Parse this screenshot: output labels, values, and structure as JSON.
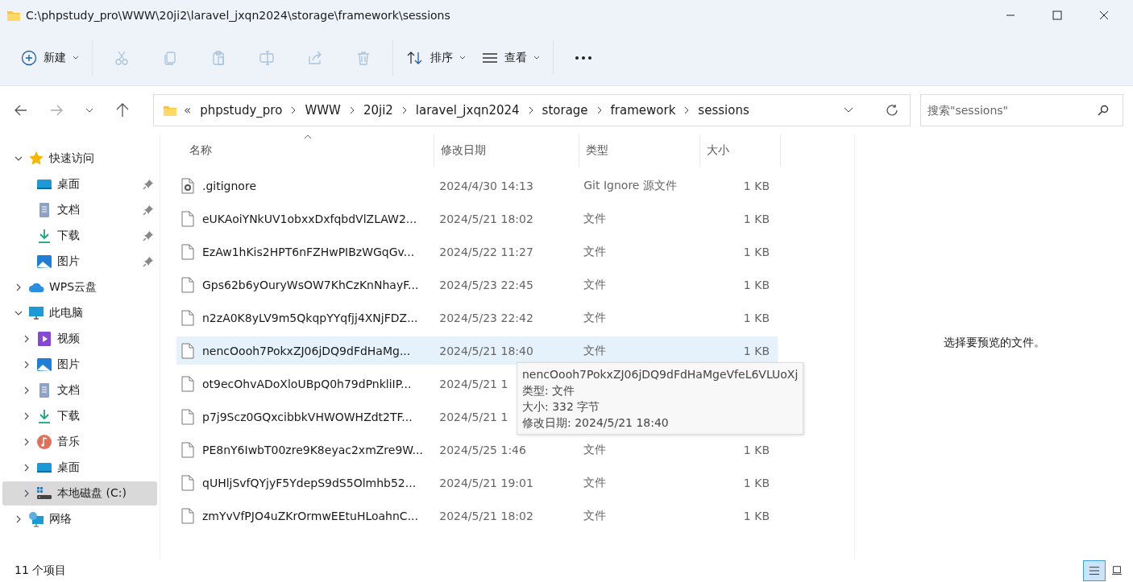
{
  "window": {
    "title": "C:\\phpstudy_pro\\WWW\\20ji2\\laravel_jxqn2024\\storage\\framework\\sessions"
  },
  "toolbar": {
    "new_label": "新建",
    "actions": [
      {
        "kind": "cut",
        "disabled": true
      },
      {
        "kind": "copy",
        "disabled": true
      },
      {
        "kind": "paste",
        "disabled": true
      },
      {
        "kind": "rename",
        "disabled": true
      },
      {
        "kind": "share",
        "disabled": true
      },
      {
        "kind": "delete",
        "disabled": true
      }
    ],
    "sort_label": "排序",
    "view_label": "查看"
  },
  "address": {
    "overflow_mark": "«",
    "path": [
      "phpstudy_pro",
      "WWW",
      "20ji2",
      "laravel_jxqn2024",
      "storage",
      "framework",
      "sessions"
    ]
  },
  "search": {
    "placeholder": "搜索\"sessions\""
  },
  "sidebar": {
    "items": [
      {
        "label": "快速访问",
        "kind": "star",
        "expanded": true,
        "selected": false,
        "children": [
          {
            "label": "桌面",
            "kind": "desktop",
            "pinned": true,
            "selected": false
          },
          {
            "label": "文档",
            "kind": "document",
            "pinned": true,
            "selected": false
          },
          {
            "label": "下载",
            "kind": "download",
            "pinned": true,
            "selected": false
          },
          {
            "label": "图片",
            "kind": "pictures",
            "pinned": true,
            "selected": false
          }
        ]
      },
      {
        "label": "WPS云盘",
        "kind": "cloud",
        "expanded": false,
        "selected": false
      },
      {
        "label": "此电脑",
        "kind": "pc",
        "expanded": true,
        "selected": false,
        "children": [
          {
            "label": "视频",
            "kind": "video",
            "expanded": false,
            "selected": false
          },
          {
            "label": "图片",
            "kind": "pictures",
            "expanded": false,
            "selected": false
          },
          {
            "label": "文档",
            "kind": "document",
            "expanded": false,
            "selected": false
          },
          {
            "label": "下载",
            "kind": "download",
            "expanded": false,
            "selected": false
          },
          {
            "label": "音乐",
            "kind": "music",
            "expanded": false,
            "selected": false
          },
          {
            "label": "桌面",
            "kind": "desktop",
            "expanded": false,
            "selected": false
          },
          {
            "label": "本地磁盘 (C:)",
            "kind": "drive",
            "expanded": false,
            "selected": true
          }
        ]
      },
      {
        "label": "网络",
        "kind": "network",
        "expanded": false,
        "selected": false
      }
    ]
  },
  "table": {
    "columns": [
      {
        "label": "名称",
        "sorted": true
      },
      {
        "label": "修改日期"
      },
      {
        "label": "类型"
      },
      {
        "label": "大小"
      }
    ],
    "rows": [
      {
        "kind": "settings-file",
        "name": ".gitignore",
        "date": "2024/4/30 14:13",
        "type": "Git Ignore 源文件",
        "size": "1 KB",
        "selected": false
      },
      {
        "kind": "file",
        "name": "eUKAoiYNkUV1obxxDxfqbdVlZLAW2...",
        "date": "2024/5/21 18:02",
        "type": "文件",
        "size": "1 KB",
        "selected": false
      },
      {
        "kind": "file",
        "name": "EzAw1hKis2HPT6nFZHwPIBzWGqGv...",
        "date": "2024/5/22 11:27",
        "type": "文件",
        "size": "1 KB",
        "selected": false
      },
      {
        "kind": "file",
        "name": "Gps62b6yOuryWsOW7KhCzKnNhayF...",
        "date": "2024/5/23 22:45",
        "type": "文件",
        "size": "1 KB",
        "selected": false
      },
      {
        "kind": "file",
        "name": "n2zA0K8yLV9m5QkqpYYqfjj4XNjFDZ...",
        "date": "2024/5/23 22:42",
        "type": "文件",
        "size": "1 KB",
        "selected": false
      },
      {
        "kind": "file",
        "name": "nencOooh7PokxZJ06jDQ9dFdHaMg...",
        "date": "2024/5/21 18:40",
        "type": "文件",
        "size": "1 KB",
        "selected": true
      },
      {
        "kind": "file",
        "name": "ot9ecOhvADoXloUBpQ0h79dPnkliIP...",
        "date": "2024/5/21 1",
        "selected": false
      },
      {
        "kind": "file",
        "name": "p7j9Scz0GQxcibbkVHWOWHZdt2TF...",
        "date": "2024/5/21 1",
        "selected": false
      },
      {
        "kind": "file",
        "name": "PE8nY6IwbT00zre9K8eyac2xmZre9W...",
        "date": "2024/5/25 1:46",
        "type": "文件",
        "size": "1 KB",
        "selected": false
      },
      {
        "kind": "file",
        "name": "qUHljSvfQYjyF5YdepS9dS5Olmhb52...",
        "date": "2024/5/21 19:01",
        "type": "文件",
        "size": "1 KB",
        "selected": false
      },
      {
        "kind": "file",
        "name": "zmYvVfPJO4uZKrOrmwEEtuHLoahnC...",
        "date": "2024/5/21 18:02",
        "type": "文件",
        "size": "1 KB",
        "selected": false
      }
    ]
  },
  "tooltip": {
    "lines": [
      "nencOooh7PokxZJ06jDQ9dFdHaMgeVfeL6VLUoXj",
      "类型: 文件",
      "大小: 332 字节",
      "修改日期: 2024/5/21 18:40"
    ]
  },
  "preview": {
    "message": "选择要预览的文件。"
  },
  "status_bar": {
    "count": "11 个项目",
    "views": [
      {
        "kind": "details",
        "selected": true
      },
      {
        "kind": "tiles",
        "selected": false
      }
    ]
  }
}
